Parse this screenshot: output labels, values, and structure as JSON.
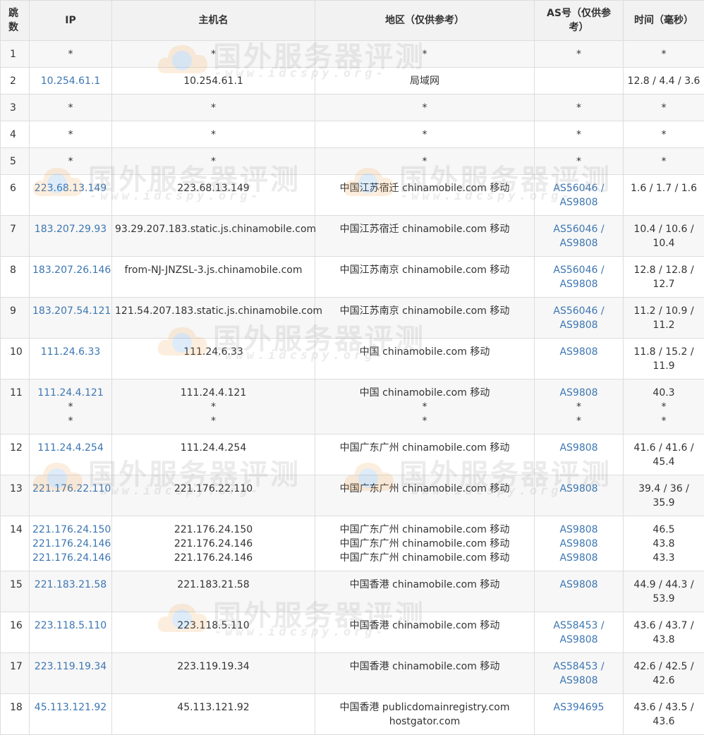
{
  "headers": {
    "hop": "跳\n数",
    "ip": "IP",
    "host": "主机名",
    "region": "地区（仅供参考）",
    "as": "AS号（仅供参\n考）",
    "time": "时间（毫秒）"
  },
  "watermark": {
    "title": "国外服务器评测",
    "url": "-www.idcspy.org-"
  },
  "rows": [
    {
      "hop": "1",
      "ip": [
        "*"
      ],
      "host": [
        "*"
      ],
      "region": [
        "*"
      ],
      "as": [
        "*"
      ],
      "time": [
        "*"
      ]
    },
    {
      "hop": "2",
      "ip": [
        "10.254.61.1"
      ],
      "host": [
        "10.254.61.1"
      ],
      "region": [
        "局域网"
      ],
      "as": [
        ""
      ],
      "time": [
        "12.8 / 4.4 / 3.6"
      ]
    },
    {
      "hop": "3",
      "ip": [
        "*"
      ],
      "host": [
        "*"
      ],
      "region": [
        "*"
      ],
      "as": [
        "*"
      ],
      "time": [
        "*"
      ]
    },
    {
      "hop": "4",
      "ip": [
        "*"
      ],
      "host": [
        "*"
      ],
      "region": [
        "*"
      ],
      "as": [
        "*"
      ],
      "time": [
        "*"
      ]
    },
    {
      "hop": "5",
      "ip": [
        "*"
      ],
      "host": [
        "*"
      ],
      "region": [
        "*"
      ],
      "as": [
        "*"
      ],
      "time": [
        "*"
      ]
    },
    {
      "hop": "6",
      "ip": [
        "223.68.13.149"
      ],
      "host": [
        "223.68.13.149"
      ],
      "region": [
        "中国江苏宿迁 chinamobile.com 移动"
      ],
      "as": [
        "AS56046 /",
        "AS9808"
      ],
      "time": [
        "1.6 / 1.7 / 1.6"
      ]
    },
    {
      "hop": "7",
      "ip": [
        "183.207.29.93"
      ],
      "host": [
        "93.29.207.183.static.js.chinamobile.com"
      ],
      "region": [
        "中国江苏宿迁 chinamobile.com 移动"
      ],
      "as": [
        "AS56046 /",
        "AS9808"
      ],
      "time": [
        "10.4 / 10.6 /",
        "10.4"
      ]
    },
    {
      "hop": "8",
      "ip": [
        "183.207.26.146"
      ],
      "host": [
        "from-NJ-JNZSL-3.js.chinamobile.com"
      ],
      "region": [
        "中国江苏南京 chinamobile.com 移动"
      ],
      "as": [
        "AS56046 /",
        "AS9808"
      ],
      "time": [
        "12.8 / 12.8 /",
        "12.7"
      ]
    },
    {
      "hop": "9",
      "ip": [
        "183.207.54.121"
      ],
      "host": [
        "121.54.207.183.static.js.chinamobile.com"
      ],
      "region": [
        "中国江苏南京 chinamobile.com 移动"
      ],
      "as": [
        "AS56046 /",
        "AS9808"
      ],
      "time": [
        "11.2 / 10.9 /",
        "11.2"
      ]
    },
    {
      "hop": "10",
      "ip": [
        "111.24.6.33"
      ],
      "host": [
        "111.24.6.33"
      ],
      "region": [
        "中国 chinamobile.com 移动"
      ],
      "as": [
        "AS9808"
      ],
      "time": [
        "11.8 / 15.2 /",
        "11.9"
      ]
    },
    {
      "hop": "11",
      "ip": [
        "111.24.4.121",
        "*",
        "*"
      ],
      "host": [
        "111.24.4.121",
        "*",
        "*"
      ],
      "region": [
        "中国 chinamobile.com 移动",
        "*",
        "*"
      ],
      "as": [
        "AS9808",
        "*",
        "*"
      ],
      "time": [
        "40.3",
        "*",
        "*"
      ]
    },
    {
      "hop": "12",
      "ip": [
        "111.24.4.254"
      ],
      "host": [
        "111.24.4.254"
      ],
      "region": [
        "中国广东广州 chinamobile.com 移动"
      ],
      "as": [
        "AS9808"
      ],
      "time": [
        "41.6 / 41.6 /",
        "45.4"
      ]
    },
    {
      "hop": "13",
      "ip": [
        "221.176.22.110"
      ],
      "host": [
        "221.176.22.110"
      ],
      "region": [
        "中国广东广州 chinamobile.com 移动"
      ],
      "as": [
        "AS9808"
      ],
      "time": [
        "39.4 / 36 /",
        "35.9"
      ]
    },
    {
      "hop": "14",
      "ip": [
        "221.176.24.150",
        "221.176.24.146",
        "221.176.24.146"
      ],
      "host": [
        "221.176.24.150",
        "221.176.24.146",
        "221.176.24.146"
      ],
      "region": [
        "中国广东广州 chinamobile.com 移动",
        "中国广东广州 chinamobile.com 移动",
        "中国广东广州 chinamobile.com 移动"
      ],
      "as": [
        "AS9808",
        "AS9808",
        "AS9808"
      ],
      "time": [
        "46.5",
        "43.8",
        "43.3"
      ]
    },
    {
      "hop": "15",
      "ip": [
        "221.183.21.58"
      ],
      "host": [
        "221.183.21.58"
      ],
      "region": [
        "中国香港 chinamobile.com 移动"
      ],
      "as": [
        "AS9808"
      ],
      "time": [
        "44.9 / 44.3 /",
        "53.9"
      ]
    },
    {
      "hop": "16",
      "ip": [
        "223.118.5.110"
      ],
      "host": [
        "223.118.5.110"
      ],
      "region": [
        "中国香港 chinamobile.com 移动"
      ],
      "as": [
        "AS58453 /",
        "AS9808"
      ],
      "time": [
        "43.6 / 43.7 /",
        "43.8"
      ]
    },
    {
      "hop": "17",
      "ip": [
        "223.119.19.34"
      ],
      "host": [
        "223.119.19.34"
      ],
      "region": [
        "中国香港 chinamobile.com 移动"
      ],
      "as": [
        "AS58453 /",
        "AS9808"
      ],
      "time": [
        "42.6 / 42.5 /",
        "42.6"
      ]
    },
    {
      "hop": "18",
      "ip": [
        "45.113.121.92"
      ],
      "host": [
        "45.113.121.92"
      ],
      "region": [
        "中国香港 publicdomainregistry.com",
        "hostgator.com"
      ],
      "as": [
        "AS394695"
      ],
      "time": [
        "43.6 / 43.5 /",
        "43.6"
      ]
    }
  ],
  "colors": {
    "link": "#3c76b2",
    "header_bg": "#f2f2f2",
    "alt_row_bg": "#f7f7f7",
    "border": "#dddddd"
  }
}
